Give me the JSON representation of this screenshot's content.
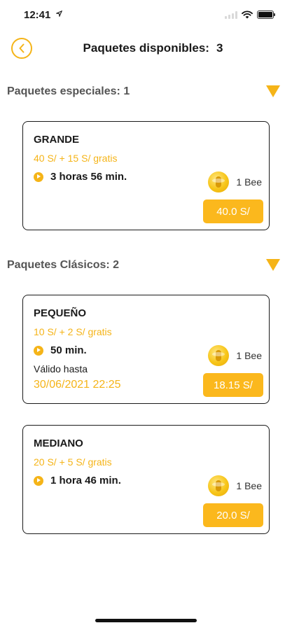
{
  "status_bar": {
    "time": "12:41"
  },
  "header": {
    "title": "Paquetes disponibles:",
    "count": "3"
  },
  "sections": [
    {
      "label": "Paquetes especiales: 1",
      "packages": [
        {
          "name": "GRANDE",
          "price_text": "40 S/ + 15 S/ gratis",
          "duration": "3 horas 56 min.",
          "bee_label": "1 Bee",
          "price_button": "40.0 S/"
        }
      ]
    },
    {
      "label": "Paquetes Clásicos: 2",
      "packages": [
        {
          "name": "PEQUEÑO",
          "price_text": "10 S/ + 2 S/ gratis",
          "duration": "50 min.",
          "valid_label": "Válido hasta",
          "valid_date": "30/06/2021 22:25",
          "bee_label": "1 Bee",
          "price_button": "18.15 S/"
        },
        {
          "name": "MEDIANO",
          "price_text": "20 S/ + 5 S/ gratis",
          "duration": "1 hora 46 min.",
          "bee_label": "1 Bee",
          "price_button": "20.0 S/"
        }
      ]
    }
  ],
  "colors": {
    "accent": "#f5b418",
    "price_button": "#fbb81d",
    "card_border": "#1a1a1a",
    "section_label": "#555555"
  },
  "icons": {
    "back": "chevron-left-icon",
    "toggle": "triangle-down-icon",
    "duration": "play-icon",
    "bee": "bee-coin-icon"
  }
}
